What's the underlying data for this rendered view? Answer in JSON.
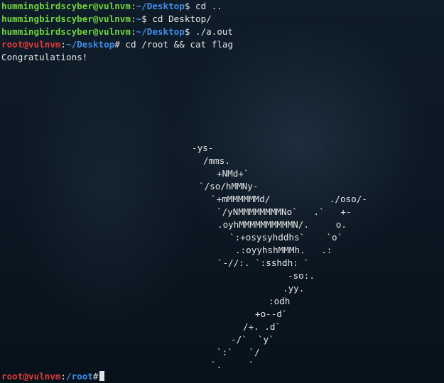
{
  "terminal": {
    "lines": [
      {
        "user": "hummingbirdscyber@vulnvm",
        "sep": ":",
        "path": "~/Desktop",
        "prompt": "$",
        "command": " cd .."
      },
      {
        "user": "hummingbirdscyber@vulnvm",
        "sep": ":",
        "path": "~",
        "prompt": "$",
        "command": " cd Desktop/"
      },
      {
        "user": "hummingbirdscyber@vulnvm",
        "sep": ":",
        "path": "~/Desktop",
        "prompt": "$",
        "command": " ./a.out"
      },
      {
        "user": "root@vulnvm",
        "sep": ":",
        "path": "~/Desktop",
        "prompt": "#",
        "command": " cd /root && cat flag"
      }
    ],
    "output": "Congratulations!",
    "ascii_art": [
      "-ys-",
      "/mms.",
      "+NMd+`",
      "`/so/hMMNy-",
      "`+mMMMMMMd/           ./oso/-",
      "`/yNMMMMMMMMNo`   .`   +-",
      ".oyhMMMMMMMMMMN/.     o.",
      "`:+osysyhddhs`    `o`",
      ".:oyyhshMMMh.   .:",
      "`-//:. `:sshdh: `",
      "-so:.",
      ".yy.",
      ":odh",
      "+o--d`",
      "/+. .d`",
      "-/`  `y`",
      "`:`   `/",
      "`.     `"
    ],
    "final_prompt": {
      "user": "root@vulnvm",
      "sep": ":",
      "path": "/root",
      "prompt": "#"
    }
  },
  "colors": {
    "user_green": "#6fd33c",
    "path_blue": "#3f8fe8",
    "root_red": "#e03a3a",
    "text": "#e6e6e6",
    "background": "#0b1622"
  }
}
